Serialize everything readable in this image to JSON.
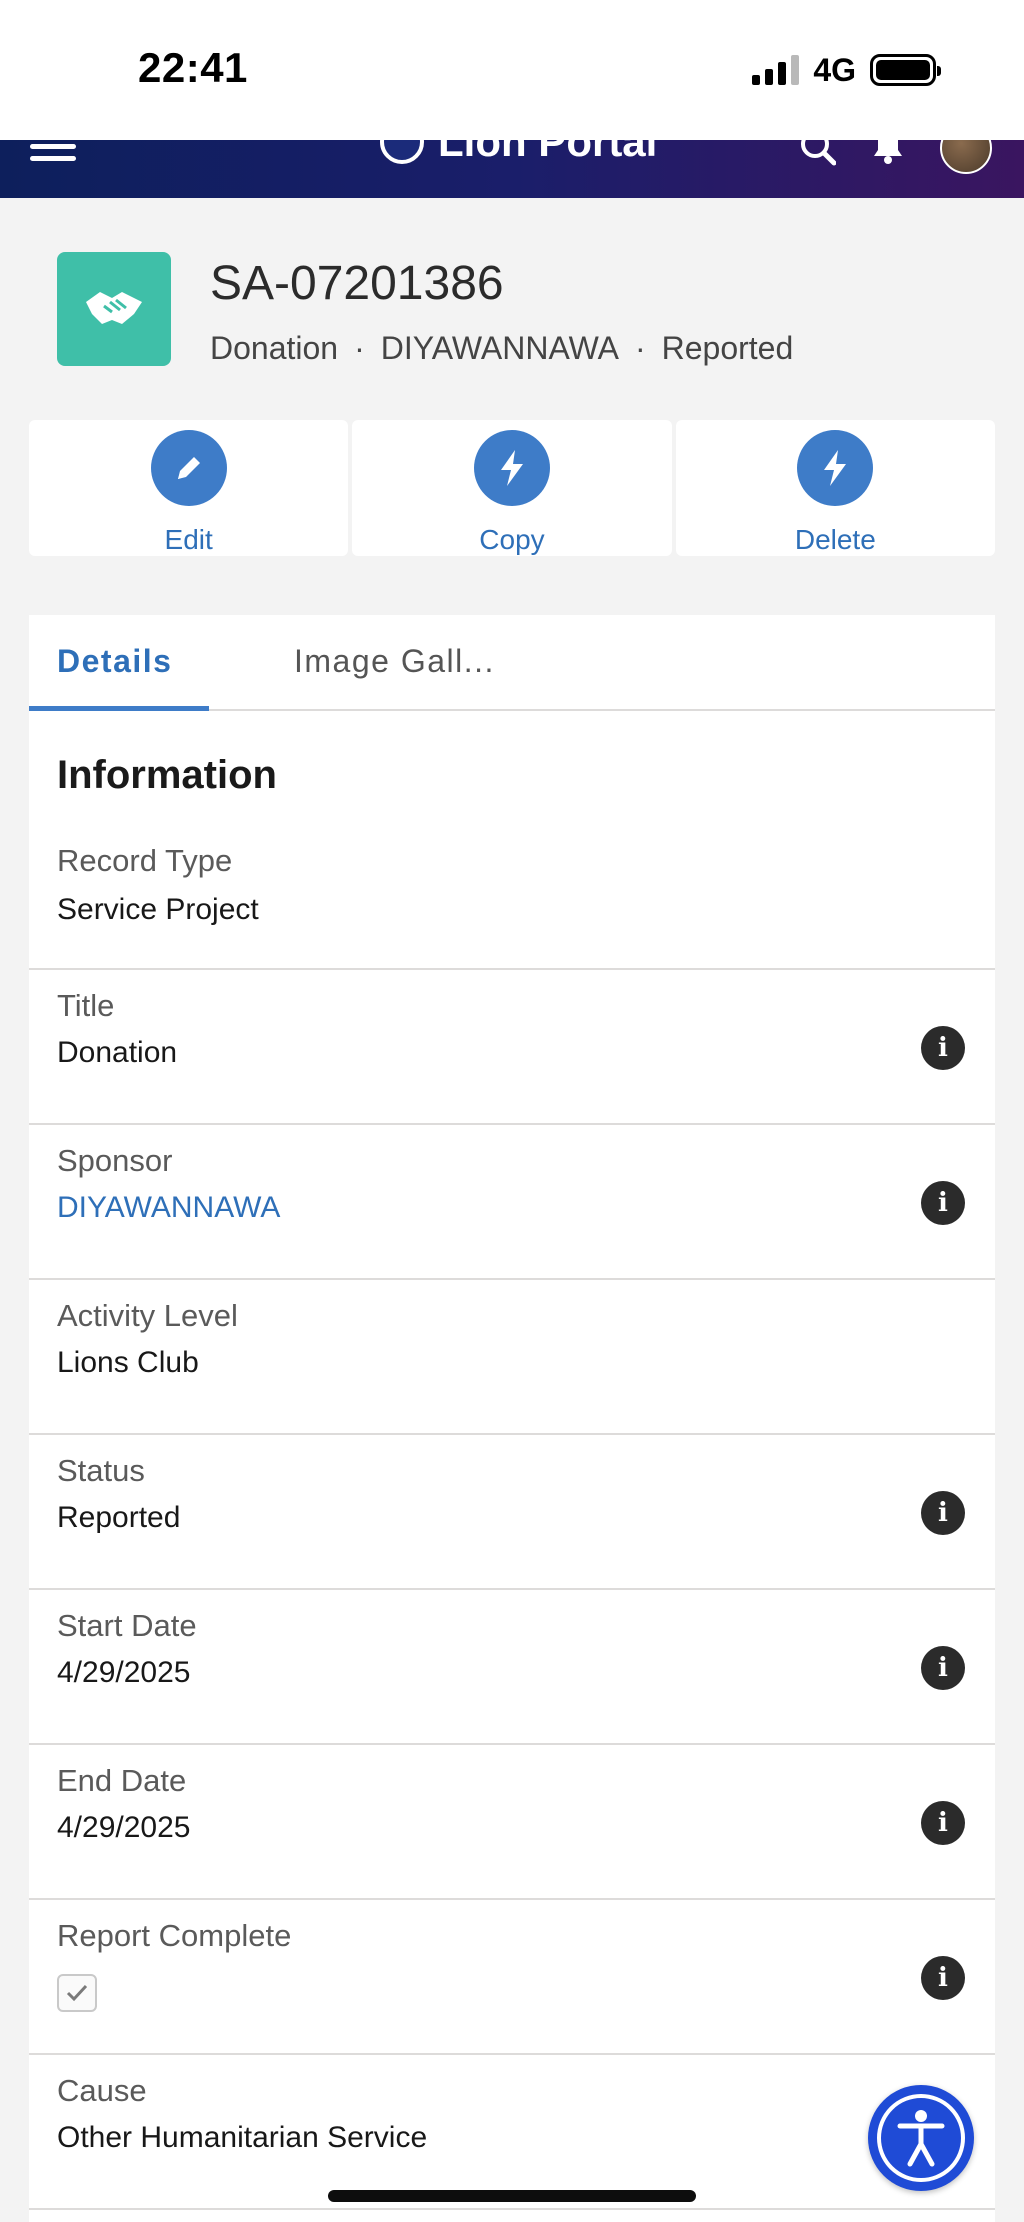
{
  "status_bar": {
    "time": "22:41",
    "network": "4G"
  },
  "header": {
    "brand": "Lion Portal"
  },
  "record": {
    "id": "SA-07201386",
    "meta": [
      "Donation",
      "DIYAWANNAWA",
      "Reported"
    ],
    "icon": "handshake-icon",
    "icon_color": "#3fbfa8"
  },
  "actions": [
    {
      "label": "Edit",
      "icon": "pencil-icon"
    },
    {
      "label": "Copy",
      "icon": "lightning-icon"
    },
    {
      "label": "Delete",
      "icon": "lightning-icon"
    }
  ],
  "tabs": [
    "Details",
    "Image Gall..."
  ],
  "section": {
    "title": "Information"
  },
  "fields": [
    {
      "label": "Record Type",
      "value": "Service Project"
    },
    {
      "label": "Title",
      "value": "Donation"
    },
    {
      "label": "Sponsor",
      "value": "DIYAWANNAWA"
    },
    {
      "label": "Activity Level",
      "value": "Lions Club"
    },
    {
      "label": "Status",
      "value": "Reported"
    },
    {
      "label": "Start Date",
      "value": "4/29/2025"
    },
    {
      "label": "End Date",
      "value": "4/29/2025"
    },
    {
      "label": "Report Complete",
      "checked": true
    },
    {
      "label": "Cause",
      "value": "Other Humanitarian Service"
    }
  ],
  "colors": {
    "accent": "#3e7cc8",
    "link": "#2e6fb8",
    "a11y": "#1f4bd6"
  }
}
